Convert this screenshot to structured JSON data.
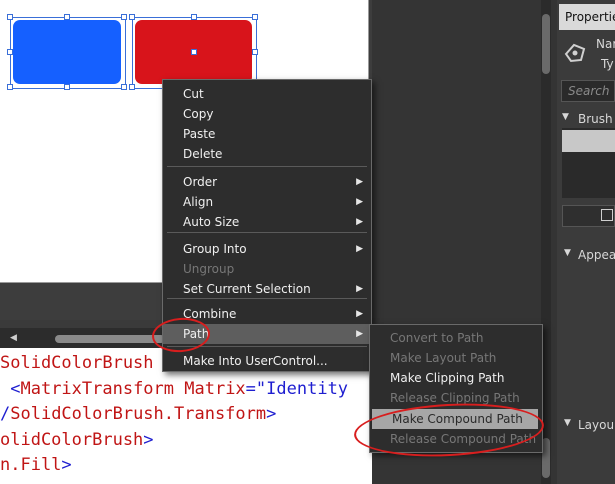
{
  "context_menu": {
    "items": [
      {
        "label": "Cut",
        "submenu": false,
        "enabled": true
      },
      {
        "label": "Copy",
        "submenu": false,
        "enabled": true
      },
      {
        "label": "Paste",
        "submenu": false,
        "enabled": true
      },
      {
        "label": "Delete",
        "submenu": false,
        "enabled": true
      },
      {
        "label": "Order",
        "submenu": true,
        "enabled": true
      },
      {
        "label": "Align",
        "submenu": true,
        "enabled": true
      },
      {
        "label": "Auto Size",
        "submenu": true,
        "enabled": true
      },
      {
        "label": "Group Into",
        "submenu": true,
        "enabled": true
      },
      {
        "label": "Ungroup",
        "submenu": false,
        "enabled": false
      },
      {
        "label": "Set Current Selection",
        "submenu": true,
        "enabled": true
      },
      {
        "label": "Combine",
        "submenu": true,
        "enabled": true
      },
      {
        "label": "Path",
        "submenu": true,
        "enabled": true,
        "highlighted": true
      },
      {
        "label": "Make Into UserControl...",
        "submenu": false,
        "enabled": true
      }
    ]
  },
  "path_submenu": {
    "items": [
      {
        "label": "Convert to Path",
        "enabled": false
      },
      {
        "label": "Make Layout Path",
        "enabled": false
      },
      {
        "label": "Make Clipping Path",
        "enabled": true
      },
      {
        "label": "Release Clipping Path",
        "enabled": false
      },
      {
        "label": "Make Compound Path",
        "enabled": true,
        "highlighted": true
      },
      {
        "label": "Release Compound Path",
        "enabled": false
      }
    ]
  },
  "code_lines": [
    [
      {
        "t": "SolidColorBrush",
        "c": "red"
      }
    ],
    [
      {
        "t": " <",
        "c": "blue"
      },
      {
        "t": "MatrixTransform",
        "c": "red"
      },
      {
        "t": " Matrix",
        "c": "red"
      },
      {
        "t": "=\"",
        "c": "blue"
      },
      {
        "t": "Identity",
        "c": "blue"
      }
    ],
    [
      {
        "t": "/",
        "c": "blue"
      },
      {
        "t": "SolidColorBrush.Transform",
        "c": "red"
      },
      {
        "t": ">",
        "c": "blue"
      }
    ],
    [
      {
        "t": "olidColorBrush",
        "c": "red"
      },
      {
        "t": ">",
        "c": "blue"
      }
    ],
    [
      {
        "t": "n.Fill",
        "c": "red"
      },
      {
        "t": ">",
        "c": "blue"
      }
    ]
  ],
  "properties_panel": {
    "tab_label": "Propertie",
    "name_label": "Nar",
    "type_label": "Ty",
    "search_placeholder": "Search",
    "brushes_header": "Brush",
    "appearance_header": "Appea",
    "layout_header": "Layou"
  },
  "colors": {
    "blue_rectangle": "#1560ff",
    "red_rectangle": "#d8141b",
    "annotation": "#d81e1e",
    "menu_background": "#2d2d2d"
  },
  "icons": [
    "pen-tool-icon",
    "chevron-right-icon",
    "triangle-down-icon",
    "scroll-left-icon"
  ]
}
